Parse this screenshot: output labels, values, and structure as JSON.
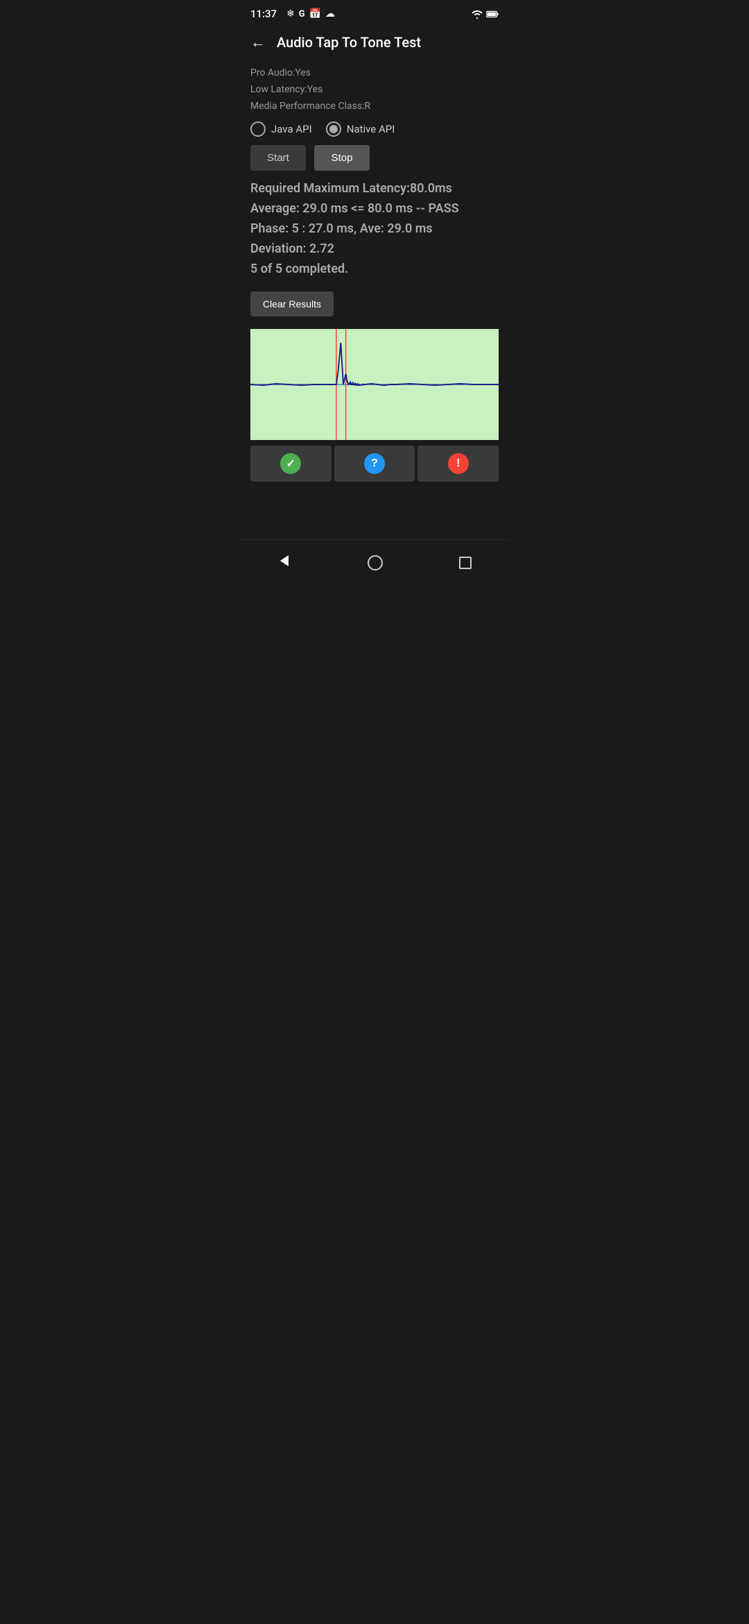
{
  "statusBar": {
    "time": "11:37",
    "iconsLeft": [
      "fan-icon",
      "google-icon",
      "calendar-icon",
      "cloud-icon"
    ],
    "iconsRight": [
      "wifi-icon",
      "battery-icon"
    ]
  },
  "header": {
    "backLabel": "←",
    "title": "Audio Tap To Tone Test"
  },
  "deviceInfo": {
    "proAudio": "Pro Audio:Yes",
    "lowLatency": "Low Latency:Yes",
    "mediaPerformance": "Media Performance Class:R"
  },
  "apiSelector": {
    "javaApi": {
      "label": "Java API",
      "selected": false
    },
    "nativeApi": {
      "label": "Native API",
      "selected": true
    }
  },
  "buttons": {
    "start": "Start",
    "stop": "Stop"
  },
  "results": {
    "line1": "Required Maximum Latency:80.0ms",
    "line2": "Average: 29.0 ms <= 80.0 ms -- PASS",
    "line3": "Phase: 5 : 27.0 ms, Ave: 29.0 ms",
    "line4": "Deviation: 2.72",
    "line5": "5 of 5 completed."
  },
  "clearButton": "Clear Results",
  "statusIcons": {
    "pass": "✓",
    "question": "?",
    "warning": "!"
  }
}
